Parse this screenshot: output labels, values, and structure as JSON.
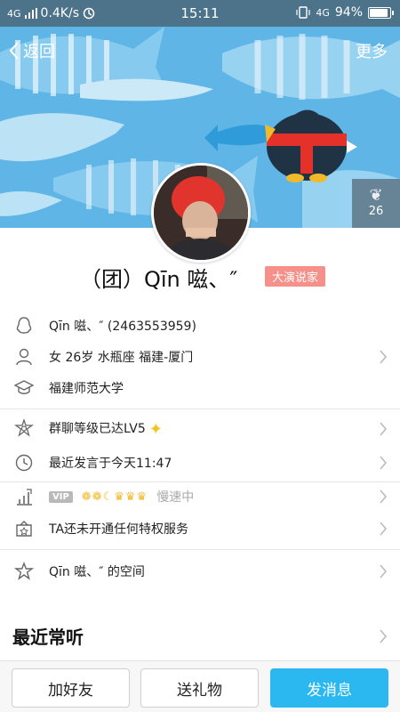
{
  "status_bar": {
    "network": "4G",
    "speed": "0.4K/s",
    "time": "15:11",
    "network_right": "4G",
    "battery": "94%",
    "battery_level": 0.94
  },
  "nav": {
    "back_label": "返回",
    "more_label": "更多"
  },
  "likes": {
    "count": "26",
    "icon": "leaf-icon"
  },
  "profile": {
    "name": "（团）Qīn 嗞、″",
    "badge": "大演说家"
  },
  "info": {
    "qq": "Qīn 嗞、″ (2463553959)",
    "personal": "女  26岁  水瓶座  福建-厦门",
    "school": "福建师范大学",
    "group_level": "群聊等级已达LV5",
    "last_speak": "最近发言于今天11:47",
    "vip_tag": "VIP",
    "vip_icons": "❁❁☾♛♛♛",
    "vip_status": "慢速中",
    "privilege": "TA还未开通任何特权服务",
    "space": "Qīn 嗞、″ 的空间"
  },
  "section": {
    "recent_listen": "最近常听"
  },
  "buttons": {
    "add_friend": "加好友",
    "send_gift": "送礼物",
    "send_message": "发消息"
  },
  "colors": {
    "accent": "#2bb8f0",
    "badge": "#f5918a",
    "cover": "#5fb6e6"
  }
}
